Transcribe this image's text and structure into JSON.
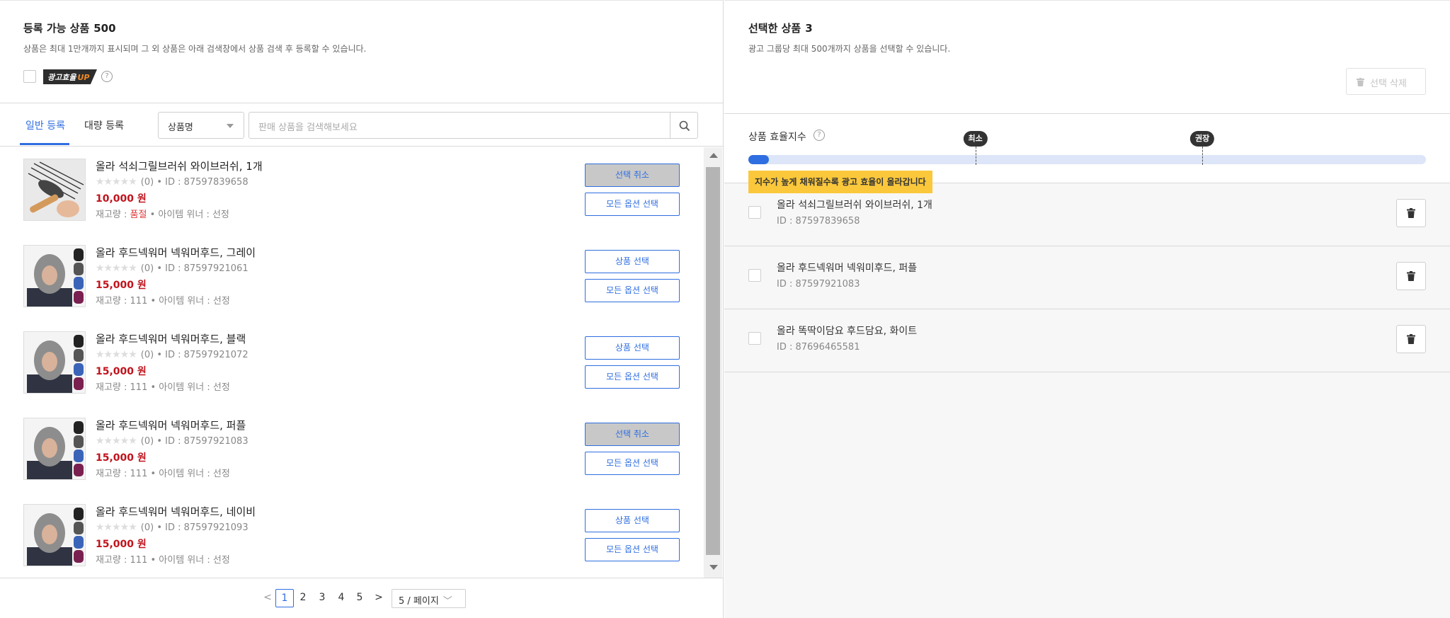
{
  "left": {
    "title": "등록 가능 상품",
    "count": "500",
    "description": "상품은 최대 1만개까지 표시되며 그 외 상품은 아래 검색창에서 상품 검색 후 등록할 수 있습니다.",
    "badge_text": "광고효율",
    "badge_up": "UP",
    "help_glyph": "?",
    "tabs": [
      {
        "label": "일반 등록",
        "active": true
      },
      {
        "label": "대량 등록",
        "active": false
      }
    ],
    "filter": {
      "selected": "상품명"
    },
    "search": {
      "placeholder": "판매 상품을 검색해보세요"
    },
    "products": [
      {
        "name": "올라 석쇠그릴브러쉬 와이브러쉬, 1개",
        "reviews": "(0)",
        "id": "ID : 87597839658",
        "price": "10,000 원",
        "stock_label": "재고량 : ",
        "stock_value": "품절",
        "soldout": true,
        "winner": "아이템 위너 : 선정",
        "select_label": "선택 취소",
        "selected": true,
        "all_label": "모든 옵션 선택",
        "thumb": "grill-brush"
      },
      {
        "name": "올라 후드넥워머 넥워머후드, 그레이",
        "reviews": "(0)",
        "id": "ID : 87597921061",
        "price": "15,000 원",
        "stock_label": "재고량 : ",
        "stock_value": "111",
        "soldout": false,
        "winner": "아이템 위너 : 선정",
        "select_label": "상품 선택",
        "selected": false,
        "all_label": "모든 옵션 선택",
        "thumb": "hood"
      },
      {
        "name": "올라 후드넥워머 넥워머후드, 블랙",
        "reviews": "(0)",
        "id": "ID : 87597921072",
        "price": "15,000 원",
        "stock_label": "재고량 : ",
        "stock_value": "111",
        "soldout": false,
        "winner": "아이템 위너 : 선정",
        "select_label": "상품 선택",
        "selected": false,
        "all_label": "모든 옵션 선택",
        "thumb": "hood"
      },
      {
        "name": "올라 후드넥워머 넥워머후드, 퍼플",
        "reviews": "(0)",
        "id": "ID : 87597921083",
        "price": "15,000 원",
        "stock_label": "재고량 : ",
        "stock_value": "111",
        "soldout": false,
        "winner": "아이템 위너 : 선정",
        "select_label": "선택 취소",
        "selected": true,
        "all_label": "모든 옵션 선택",
        "thumb": "hood"
      },
      {
        "name": "올라 후드넥워머 넥워머후드, 네이비",
        "reviews": "(0)",
        "id": "ID : 87597921093",
        "price": "15,000 원",
        "stock_label": "재고량 : ",
        "stock_value": "111",
        "soldout": false,
        "winner": "아이템 위너 : 선정",
        "select_label": "상품 선택",
        "selected": false,
        "all_label": "모든 옵션 선택",
        "thumb": "hood"
      }
    ],
    "pagination": {
      "prev": "<",
      "pages": [
        "1",
        "2",
        "3",
        "4",
        "5"
      ],
      "current": "1",
      "next": ">",
      "per_page": "5 / 페이지",
      "per_page_chevron": "﹀"
    }
  },
  "right": {
    "title": "선택한 상품",
    "count": "3",
    "description": "광고 그룹당 최대 500개까지 상품을 선택할 수 있습니다.",
    "delete_selected": "선택 삭제",
    "efficiency": {
      "label": "상품 효율지수",
      "help_glyph": "?",
      "fill_fraction": 0.03,
      "min_label": "최소",
      "min_fraction": 0.335,
      "recommended_label": "권장",
      "recommended_fraction": 0.67,
      "tooltip": "지수가 높게 채워질수록 광고 효율이 올라갑니다"
    },
    "items": [
      {
        "name": "올라 석쇠그릴브러쉬 와이브러쉬, 1개",
        "id": "ID : 87597839658"
      },
      {
        "name": "올라 후드넥워머 넥워미후드, 퍼플",
        "id": "ID : 87597921083"
      },
      {
        "name": "올라 똑딱이담요 후드담요, 화이트",
        "id": "ID : 87696465581"
      }
    ]
  },
  "colors": {
    "accent": "#2f6ee0",
    "price": "#c0131c",
    "soldout": "#e03c3c",
    "tooltip": "#fbc83c"
  }
}
